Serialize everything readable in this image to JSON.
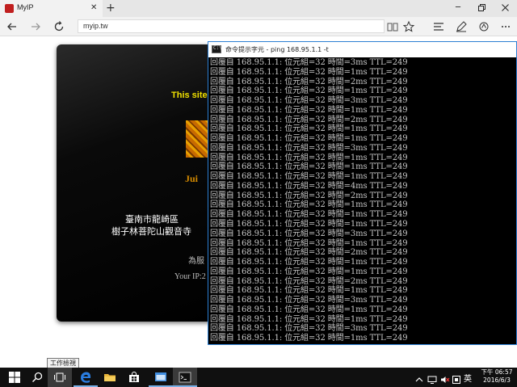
{
  "browser": {
    "tab_title": "MyIP",
    "tab_close": "✕",
    "new_tab": "+",
    "window_minimize": "─",
    "address_value": "myip.tw"
  },
  "site": {
    "banner": "This site",
    "logo_text": "Jui",
    "address_line1": "臺南市龍崎區",
    "address_line2": "樹子林菩陀山觀音寺",
    "served_label": "為服",
    "your_ip_label": "Your IP:2"
  },
  "cmd": {
    "title": "命令提示字元 - ping  168.95.1.1 -t",
    "icon_text": "C:\\",
    "lines": [
      "回覆自 168.95.1.1: 位元組=32 時間=3ms TTL=249",
      "回覆自 168.95.1.1: 位元組=32 時間=1ms TTL=249",
      "回覆自 168.95.1.1: 位元組=32 時間=2ms TTL=249",
      "回覆自 168.95.1.1: 位元組=32 時間=1ms TTL=249",
      "回覆自 168.95.1.1: 位元組=32 時間=3ms TTL=249",
      "回覆自 168.95.1.1: 位元組=32 時間=1ms TTL=249",
      "回覆自 168.95.1.1: 位元組=32 時間=2ms TTL=249",
      "回覆自 168.95.1.1: 位元組=32 時間=1ms TTL=249",
      "回覆自 168.95.1.1: 位元組=32 時間=1ms TTL=249",
      "回覆自 168.95.1.1: 位元組=32 時間=3ms TTL=249",
      "回覆自 168.95.1.1: 位元組=32 時間=1ms TTL=249",
      "回覆自 168.95.1.1: 位元組=32 時間=1ms TTL=249",
      "回覆自 168.95.1.1: 位元組=32 時間=1ms TTL=249",
      "回覆自 168.95.1.1: 位元組=32 時間=4ms TTL=249",
      "回覆自 168.95.1.1: 位元組=32 時間=2ms TTL=249",
      "回覆自 168.95.1.1: 位元組=32 時間=1ms TTL=249",
      "回覆自 168.95.1.1: 位元組=32 時間=1ms TTL=249",
      "回覆自 168.95.1.1: 位元組=32 時間=1ms TTL=249",
      "回覆自 168.95.1.1: 位元組=32 時間=3ms TTL=249",
      "回覆自 168.95.1.1: 位元組=32 時間=1ms TTL=249",
      "回覆自 168.95.1.1: 位元組=32 時間=2ms TTL=249",
      "回覆自 168.95.1.1: 位元組=32 時間=1ms TTL=249",
      "回覆自 168.95.1.1: 位元組=32 時間=1ms TTL=249",
      "回覆自 168.95.1.1: 位元組=32 時間=2ms TTL=249",
      "回覆自 168.95.1.1: 位元組=32 時間=1ms TTL=249",
      "回覆自 168.95.1.1: 位元組=32 時間=3ms TTL=249",
      "回覆自 168.95.1.1: 位元組=32 時間=1ms TTL=249",
      "回覆自 168.95.1.1: 位元組=32 時間=1ms TTL=249",
      "回覆自 168.95.1.1: 位元組=32 時間=3ms TTL=249",
      "回覆自 168.95.1.1: 位元組=32 時間=1ms TTL=249"
    ]
  },
  "tooltip": "工作檢視",
  "taskbar": {
    "language": "英",
    "time": "下午 06:57",
    "date": "2016/6/3"
  },
  "icons": {
    "back": "arrow-left-icon",
    "forward": "arrow-right-icon",
    "refresh": "refresh-icon",
    "reading_view": "book-icon",
    "favorite": "star-icon",
    "hub": "hub-lines-icon",
    "notes": "pen-note-icon",
    "share": "share-icon",
    "more": "ellipsis-icon"
  },
  "colors": {
    "banner_yellow": "#f0e000",
    "cmd_border": "#2d7fd3",
    "edge_blue": "#2a7de1"
  }
}
